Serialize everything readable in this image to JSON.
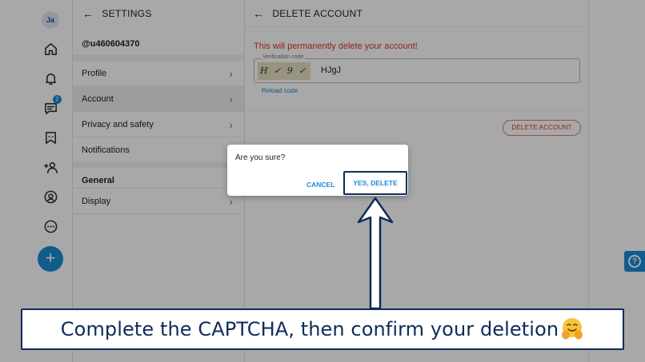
{
  "rail": {
    "avatar": "Ja",
    "messages_badge": "2",
    "icons": [
      "home-icon",
      "bell-icon",
      "messages-icon",
      "bookmark-icon",
      "people-icon",
      "profile-icon",
      "more-icon"
    ],
    "fab": "+"
  },
  "settings": {
    "title": "SETTINGS",
    "user_id": "@u460604370",
    "rows": [
      {
        "label": "Profile"
      },
      {
        "label": "Account"
      },
      {
        "label": "Privacy and safety"
      },
      {
        "label": "Notifications"
      }
    ],
    "section": "General",
    "section_rows": [
      {
        "label": "Display"
      }
    ]
  },
  "delete_account": {
    "title": "DELETE ACCOUNT",
    "warning": "This will permanently delete your account!",
    "captcha_label": "Verification code",
    "captcha_image_text": "H ✓ 9 ✓",
    "captcha_value": "HJgJ",
    "reload": "Reload code",
    "delete_button": "DELETE ACCOUNT"
  },
  "dialog": {
    "question": "Are you sure?",
    "cancel": "CANCEL",
    "confirm": "YES, DELETE"
  },
  "caption": {
    "text": "Complete the CAPTCHA, then confirm your deletion",
    "emoji": "hugging-face-emoji"
  },
  "help_button": "?",
  "colors": {
    "accent": "#1a8bd6",
    "danger": "#e0342c",
    "callout": "#0e2c5a"
  }
}
